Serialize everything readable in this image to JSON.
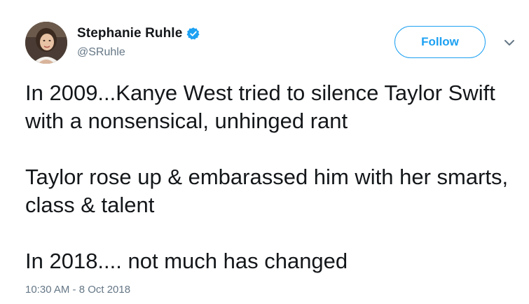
{
  "author": {
    "display_name": "Stephanie Ruhle",
    "handle": "@SRuhle",
    "verified_icon": "verified-badge-icon",
    "avatar_icon": "profile-avatar"
  },
  "actions": {
    "follow_label": "Follow",
    "more_icon": "chevron-down-icon"
  },
  "tweet": {
    "lines": [
      "In 2009...Kanye West tried to silence Taylor Swift with a nonsensical, unhinged rant",
      "Taylor rose up & embarassed him with her smarts, class & talent",
      "In 2018.... not much has changed"
    ],
    "timestamp": "10:30 AM - 8 Oct 2018"
  },
  "colors": {
    "accent": "#1da1f2",
    "text": "#14171a",
    "muted": "#657786"
  }
}
